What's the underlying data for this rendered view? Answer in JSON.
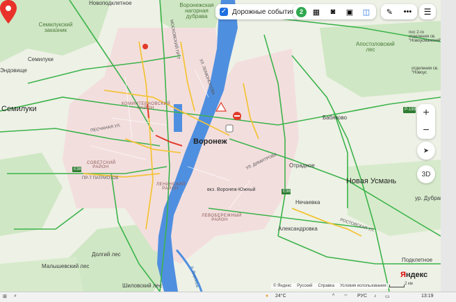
{
  "toolbar": {
    "traffic_label": "Дорожные события",
    "traffic_count": "2",
    "more_label": "•••"
  },
  "map": {
    "city": "Воронеж",
    "labels": {
      "novopodklet": "Новоподклетное",
      "semilukski": "Семилукский заказник",
      "semiluki_top": "Семилуки",
      "semiluki": "Семилуки",
      "endovishe": "Эндовище",
      "voronezh_forest": "Воронежская нагорная дубрава",
      "kominternovsky": "КОМИНТЕРНОВСКИЙ РАЙОН",
      "sovetsky": "СОВЕТСКИЙ РАЙОН",
      "leninsky": "ЛЕНИНСКИЙ РАЙОН",
      "levoberezhny": "ЛЕВОБЕРЕЖНЫЙ РАЙОН",
      "vokzal": "вкз. Воронеж-Южный",
      "babyakovo": "Бабяково",
      "otradnoe": "Отрадное",
      "novaya_usman": "Новая Усмань",
      "nechaevka": "Нечаевка",
      "aleksandrovka": "Александровка",
      "apostolovsky": "Апостоловский лес",
      "pos2": "пос 2-го отделения св. \"Новоусманский\"",
      "novous": "отделения св. \"Новоус",
      "dubrava": "ур. Дубрава",
      "podkletnoe": "Подклетное",
      "malyshev": "Малышевский лес",
      "dolgiy": "Долгий лес",
      "shilovsky": "Шиловский лес",
      "p193": "Р-193",
      "e38": "Е38",
      "e38b": "Е38",
      "rostovskaya": "РОСТОВСКАЯ УЛ.",
      "dimitrova": "УЛ. ДИМИТРОВА",
      "patriotov": "ПР-Т ПАТРИОТОВ",
      "peschanaya": "ПЕСЧАНАЯ УЛ.",
      "moskovsky": "МОСКОВСКИЙ ПР-Т",
      "lomonosova": "УЛ. ЛОМОНОСОВА",
      "r_voronezh": "р. Воронеж"
    }
  },
  "controls": {
    "zoom_in": "+",
    "zoom_out": "−",
    "mode_3d": "3D"
  },
  "footer": {
    "yandex": "© Яндекс",
    "language": "Русский",
    "help": "Справка",
    "terms": "Условия использования",
    "scale": "2 км",
    "logo_a": "Я",
    "logo_b": "ндекс"
  },
  "taskbar": {
    "temperature": "24°C",
    "lang": "РУС",
    "time": "13:19"
  },
  "colors": {
    "traffic_green": "#3bb34a",
    "traffic_yellow": "#f3c43a",
    "traffic_red": "#e23a2a",
    "water": "#4f8fe0",
    "accent": "#1e6fe0"
  }
}
